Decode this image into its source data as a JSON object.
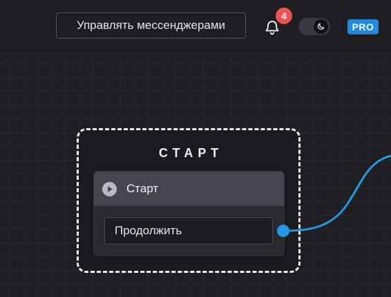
{
  "header": {
    "manage_messengers_label": "Управлять мессенджерами",
    "notifications_count": "4",
    "pro_label": "PRO"
  },
  "flow": {
    "group_title": "СТАРТ",
    "start_node": {
      "title": "Старт",
      "continue_label": "Продолжить"
    }
  },
  "colors": {
    "accent": "#1e88e5",
    "connector": "#1e9be6",
    "badge": "#ef5350"
  },
  "icons": [
    "bell-icon",
    "moon-icon",
    "play-icon"
  ]
}
